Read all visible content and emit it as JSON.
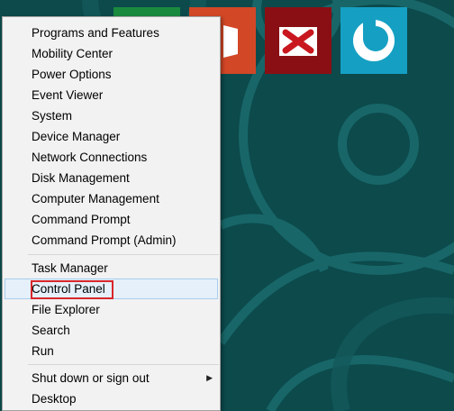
{
  "start_tiles": [
    {
      "name": "green-tile",
      "color": "#1a8a3f"
    },
    {
      "name": "office-tile",
      "color": "#d24726"
    },
    {
      "name": "xmind-tile",
      "color": "#8a0f14"
    },
    {
      "name": "simplenote-tile",
      "color": "#15a0c3"
    }
  ],
  "context_menu": {
    "groups": [
      [
        "Programs and Features",
        "Mobility Center",
        "Power Options",
        "Event Viewer",
        "System",
        "Device Manager",
        "Network Connections",
        "Disk Management",
        "Computer Management",
        "Command Prompt",
        "Command Prompt (Admin)"
      ],
      [
        "Task Manager",
        "Control Panel",
        "File Explorer",
        "Search",
        "Run"
      ],
      [
        "Shut down or sign out",
        "Desktop"
      ]
    ],
    "items": {
      "programs_features": "Programs and Features",
      "mobility_center": "Mobility Center",
      "power_options": "Power Options",
      "event_viewer": "Event Viewer",
      "system": "System",
      "device_manager": "Device Manager",
      "network_connections": "Network Connections",
      "disk_management": "Disk Management",
      "computer_management": "Computer Management",
      "command_prompt": "Command Prompt",
      "command_prompt_admin": "Command Prompt (Admin)",
      "task_manager": "Task Manager",
      "control_panel": "Control Panel",
      "file_explorer": "File Explorer",
      "search": "Search",
      "run": "Run",
      "shut_down": "Shut down or sign out",
      "desktop": "Desktop"
    },
    "highlighted_item": "Control Panel",
    "highlight_color": "#d9262b",
    "submenu_arrow": "▶"
  }
}
